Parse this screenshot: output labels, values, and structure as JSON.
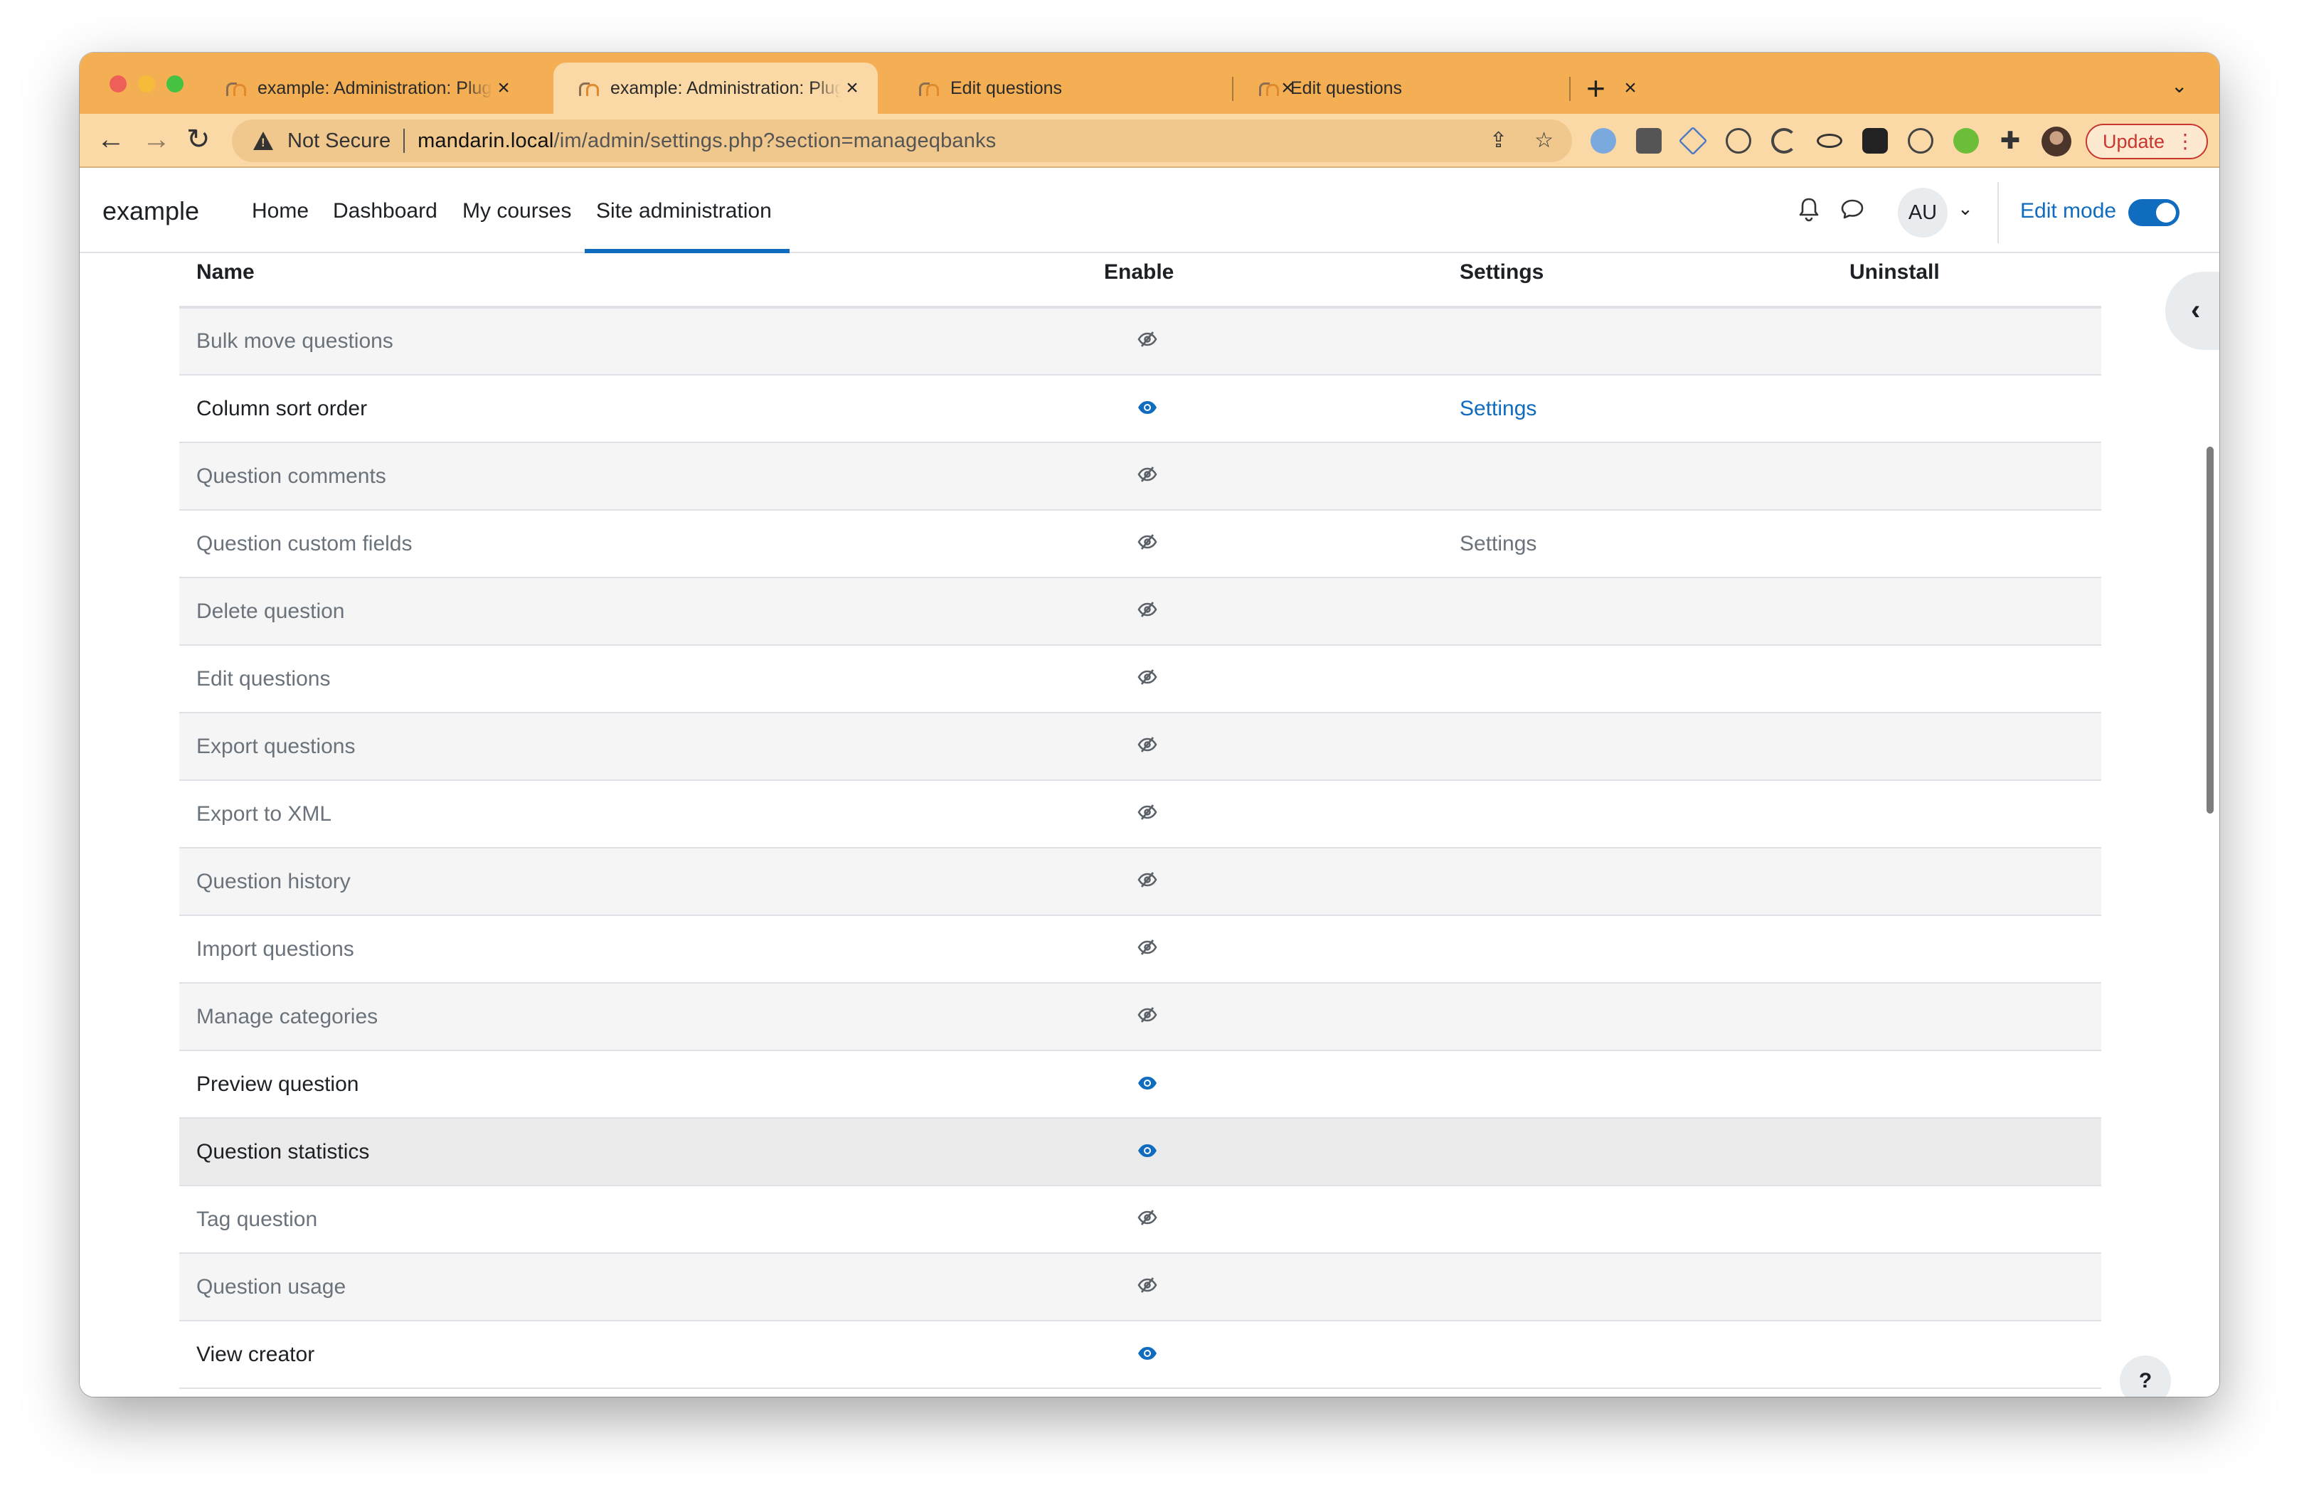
{
  "browser": {
    "tabs": [
      {
        "title": "example: Administration: Plugi",
        "active": false
      },
      {
        "title": "example: Administration: Plugi",
        "active": true
      },
      {
        "title": "Edit questions",
        "active": false
      },
      {
        "title": "Edit questions",
        "active": false
      }
    ],
    "not_secure_label": "Not Secure",
    "url_host": "mandarin.local",
    "url_path": "/im/admin/settings.php?section=manageqbanks",
    "update_label": "Update"
  },
  "navbar": {
    "brand": "example",
    "items": [
      "Home",
      "Dashboard",
      "My courses",
      "Site administration"
    ],
    "active_item": "Site administration",
    "user_initials": "AU",
    "edit_mode_label": "Edit mode",
    "edit_mode_on": true
  },
  "table": {
    "headers": {
      "name": "Name",
      "enable": "Enable",
      "settings": "Settings",
      "uninstall": "Uninstall"
    },
    "rows": [
      {
        "name": "Bulk move questions",
        "enabled": false,
        "settings": ""
      },
      {
        "name": "Column sort order",
        "enabled": true,
        "settings": "Settings"
      },
      {
        "name": "Question comments",
        "enabled": false,
        "settings": ""
      },
      {
        "name": "Question custom fields",
        "enabled": false,
        "settings": "Settings"
      },
      {
        "name": "Delete question",
        "enabled": false,
        "settings": ""
      },
      {
        "name": "Edit questions",
        "enabled": false,
        "settings": ""
      },
      {
        "name": "Export questions",
        "enabled": false,
        "settings": ""
      },
      {
        "name": "Export to XML",
        "enabled": false,
        "settings": ""
      },
      {
        "name": "Question history",
        "enabled": false,
        "settings": ""
      },
      {
        "name": "Import questions",
        "enabled": false,
        "settings": ""
      },
      {
        "name": "Manage categories",
        "enabled": false,
        "settings": ""
      },
      {
        "name": "Preview question",
        "enabled": true,
        "settings": ""
      },
      {
        "name": "Question statistics",
        "enabled": true,
        "settings": ""
      },
      {
        "name": "Tag question",
        "enabled": false,
        "settings": ""
      },
      {
        "name": "Question usage",
        "enabled": false,
        "settings": ""
      },
      {
        "name": "View creator",
        "enabled": true,
        "settings": ""
      }
    ]
  },
  "help_label": "?",
  "colors": {
    "accent": "#0f6cbf",
    "tab_strip": "#f4af55",
    "toolbar": "#fbd9a6",
    "muted_text": "#6a737b"
  }
}
